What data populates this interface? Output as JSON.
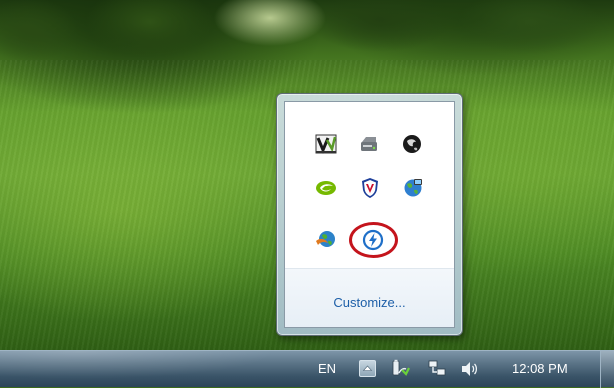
{
  "flyout": {
    "icons": [
      {
        "name": "veeam-icon"
      },
      {
        "name": "removable-drive-icon"
      },
      {
        "name": "black-globe-icon"
      },
      {
        "name": "nvidia-icon"
      },
      {
        "name": "mcafee-shield-icon"
      },
      {
        "name": "network-globe-icon"
      },
      {
        "name": "green-globe-icon"
      },
      {
        "name": "lightning-bolt-icon",
        "highlighted": true
      }
    ],
    "customize_label": "Customize..."
  },
  "taskbar": {
    "language": "EN",
    "clock": "12:08 PM",
    "icons": [
      {
        "name": "show-hidden-icons-arrow-icon"
      },
      {
        "name": "power-battery-icon"
      },
      {
        "name": "network-icon"
      },
      {
        "name": "volume-icon"
      }
    ]
  },
  "colors": {
    "highlight_ring": "#c4141c",
    "link": "#1d5fa8",
    "taskbar": "#3a5468"
  }
}
